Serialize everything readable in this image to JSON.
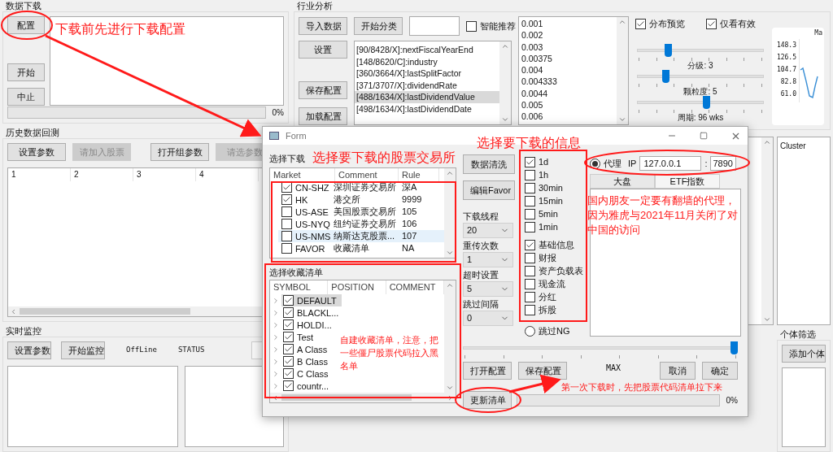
{
  "data_download": {
    "title": "数据下载",
    "buttons": [
      {
        "label": "配置"
      },
      {
        "label": "开始"
      },
      {
        "label": "中止"
      }
    ],
    "progress": {
      "level": 0,
      "reading": "0%"
    }
  },
  "backtest": {
    "title": "历史数据回测",
    "buttons": [
      {
        "label": "设置参数",
        "disabled": false
      },
      {
        "label": "请加入股票",
        "disabled": true
      },
      {
        "label": "打开组参数",
        "disabled": false
      },
      {
        "label": "请选参数",
        "disabled": true
      }
    ],
    "columns": [
      "1",
      "2",
      "3",
      "4"
    ]
  },
  "monitor": {
    "title": "实时监控",
    "buttons": [
      {
        "label": "设置参数"
      },
      {
        "label": "开始监控"
      }
    ],
    "status_labels": [
      "OffLine",
      "STATUS"
    ]
  },
  "industry": {
    "title": "行业分析",
    "top_buttons": [
      {
        "label": "导入数据"
      },
      {
        "label": "开始分类"
      }
    ],
    "smart_recommend": {
      "label": "智能推荐",
      "checked": false
    },
    "side_buttons": [
      {
        "label": "设置"
      },
      {
        "label": "保存配置"
      },
      {
        "label": "加载配置"
      }
    ],
    "fields": [
      {
        "text": "[90/8428/X]:nextFiscalYearEnd",
        "selected": false
      },
      {
        "text": "[148/8620/C]:industry",
        "selected": false
      },
      {
        "text": "[360/3664/X]:lastSplitFactor",
        "selected": false
      },
      {
        "text": "[371/3707/X]:dividendRate",
        "selected": false
      },
      {
        "text": "[488/1634/X]:lastDividendValue",
        "selected": true
      },
      {
        "text": "[498/1634/X]:lastDividendDate",
        "selected": false
      }
    ],
    "values": [
      "0.001",
      "0.002",
      "0.003",
      "0.00375",
      "0.004",
      "0.004333",
      "0.0044",
      "0.005",
      "0.006"
    ],
    "options": [
      {
        "label": "分布预览",
        "checked": true
      },
      {
        "label": "仅看有效",
        "checked": true
      }
    ],
    "sliders": [
      {
        "level": 0.23,
        "reading": "分级: 3"
      },
      {
        "level": 0.21,
        "reading": "颗粒度: 5"
      },
      {
        "level": 0.55,
        "reading": "周期: 96 wks"
      }
    ],
    "chart": {
      "title": "Ma",
      "y_labels": [
        "148.3",
        "126.5",
        "104.7",
        "82.8",
        "61.0"
      ]
    }
  },
  "cluster": {
    "header": "Cluster"
  },
  "individual": {
    "title": "个体筛选",
    "button": "添加个体"
  },
  "dialog": {
    "title": "Form",
    "market_label": "选择下载",
    "markets": {
      "columns": [
        "Market",
        "Comment",
        "Rule"
      ],
      "rows": [
        {
          "market": "CN-SHZ",
          "comment": "深圳证券交易所",
          "rule": "深A",
          "checked": true,
          "selected": false
        },
        {
          "market": "HK",
          "comment": "港交所",
          "rule": "9999",
          "checked": true,
          "selected": false
        },
        {
          "market": "US-ASE",
          "comment": "美国股票交易所",
          "rule": "105",
          "checked": false,
          "selected": false
        },
        {
          "market": "US-NYQ",
          "comment": "纽约证券交易所",
          "rule": "106",
          "checked": false,
          "selected": false
        },
        {
          "market": "US-NMS",
          "comment": "纳斯达克股票...",
          "rule": "107",
          "checked": false,
          "selected": true
        },
        {
          "market": "FAVOR",
          "comment": "收藏清单",
          "rule": "NA",
          "checked": false,
          "selected": false
        }
      ]
    },
    "favor_label": "选择收藏清单",
    "favorites": {
      "columns": [
        "SYMBOL",
        "POSITION",
        "COMMENT"
      ],
      "rows": [
        {
          "symbol": "DEFAULT",
          "checked": true,
          "selected": true
        },
        {
          "symbol": "BLACKL...",
          "checked": true,
          "selected": false
        },
        {
          "symbol": "HOLDI...",
          "checked": true,
          "selected": false
        },
        {
          "symbol": "Test",
          "checked": true,
          "selected": false
        },
        {
          "symbol": "A Class",
          "checked": true,
          "selected": false
        },
        {
          "symbol": "B Class",
          "checked": true,
          "selected": false
        },
        {
          "symbol": "C Class",
          "checked": true,
          "selected": false
        },
        {
          "symbol": "countr...",
          "checked": true,
          "selected": false
        }
      ]
    },
    "actions": [
      {
        "label": "数据清洗"
      },
      {
        "label": "编辑Favor"
      }
    ],
    "settings": [
      {
        "label": "下载线程",
        "value": "20"
      },
      {
        "label": "重传次数",
        "value": "1"
      },
      {
        "label": "超时设置",
        "value": "5"
      },
      {
        "label": "跳过间隔",
        "value": "0"
      }
    ],
    "intervals": [
      {
        "label": "1d",
        "checked": true
      },
      {
        "label": "1h",
        "checked": false
      },
      {
        "label": "30min",
        "checked": false
      },
      {
        "label": "15min",
        "checked": false
      },
      {
        "label": "5min",
        "checked": false
      },
      {
        "label": "1min",
        "checked": false
      }
    ],
    "info": [
      {
        "label": "基础信息",
        "checked": true
      },
      {
        "label": "财报",
        "checked": false
      },
      {
        "label": "资产负载表",
        "checked": false
      },
      {
        "label": "现金流",
        "checked": false
      },
      {
        "label": "分红",
        "checked": false
      },
      {
        "label": "拆股",
        "checked": false
      }
    ],
    "skip_ng": {
      "label": "跳过NG",
      "selected": false
    },
    "proxy": {
      "label": "代理",
      "selected": true,
      "ip_label": "IP",
      "ip": "127.0.0.1",
      "separator": ":",
      "port": "7890"
    },
    "tabs": [
      {
        "label": "大盘",
        "selected": true
      },
      {
        "label": "ETF指数",
        "selected": false
      }
    ],
    "slider": {
      "level": 1
    },
    "max_label": "MAX",
    "buttons": [
      {
        "label": "打开配置"
      },
      {
        "label": "保存配置"
      },
      {
        "label": "取消"
      },
      {
        "label": "确定"
      }
    ],
    "update_button": "更新清单",
    "progress": {
      "level": 0,
      "reading": "0%"
    }
  },
  "annotations": [
    {
      "text": "下载前先进行下载配置"
    },
    {
      "text": "选择要下载的股票交易所"
    },
    {
      "text": "选择要下载的信息"
    },
    {
      "text": "国内朋友一定要有翻墙的代理，因为雅虎与2021年11月关闭了对中国的访问"
    },
    {
      "text": "自建收藏清单，注意，把一些僵尸股票代码拉入黑名单"
    },
    {
      "text": "第一次下载时，先把股票代码清单拉下来"
    }
  ]
}
